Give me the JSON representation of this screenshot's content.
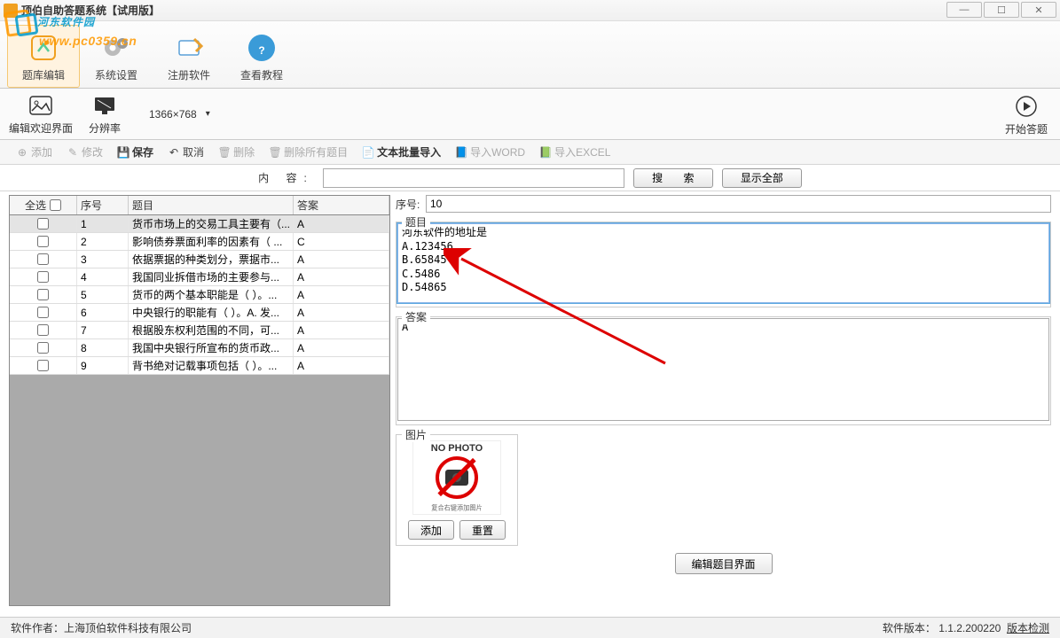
{
  "window": {
    "title": "顶伯自助答题系统【试用版】"
  },
  "watermark": {
    "text": "河东软件园",
    "url": "www.pc0359.cn"
  },
  "ribbon": {
    "items": [
      {
        "label": "题库编辑",
        "active": true
      },
      {
        "label": "系统设置",
        "active": false
      },
      {
        "label": "注册软件",
        "active": false
      },
      {
        "label": "查看教程",
        "active": false
      }
    ]
  },
  "subtoolbar": {
    "edit_welcome": "编辑欢迎界面",
    "resolution_label": "分辨率",
    "resolution_value": "1366×768",
    "start_answer": "开始答题"
  },
  "actions": {
    "add": "添加",
    "modify": "修改",
    "save": "保存",
    "cancel": "取消",
    "delete": "删除",
    "delete_all": "删除所有题目",
    "text_import": "文本批量导入",
    "import_word": "导入WORD",
    "import_excel": "导入EXCEL"
  },
  "search": {
    "label": "内 容:",
    "value": "",
    "search_btn": "搜 索",
    "showall_btn": "显示全部"
  },
  "table": {
    "select_all": "全选",
    "col_num": "序号",
    "col_title": "题目",
    "col_ans": "答案",
    "rows": [
      {
        "num": "1",
        "title": "货币市场上的交易工具主要有（...",
        "ans": "A"
      },
      {
        "num": "2",
        "title": "影响债券票面利率的因素有（ ...",
        "ans": "C"
      },
      {
        "num": "3",
        "title": "依据票据的种类划分，票据市...",
        "ans": "A"
      },
      {
        "num": "4",
        "title": "我国同业拆借市场的主要参与...",
        "ans": "A"
      },
      {
        "num": "5",
        "title": "货币的两个基本职能是（   ）。...",
        "ans": "A"
      },
      {
        "num": "6",
        "title": "中央银行的职能有（   ）。A. 发...",
        "ans": "A"
      },
      {
        "num": "7",
        "title": "根据股东权利范围的不同，可...",
        "ans": "A"
      },
      {
        "num": "8",
        "title": "我国中央银行所宣布的货币政...",
        "ans": "A"
      },
      {
        "num": "9",
        "title": "背书绝对记载事项包括（   ）。...",
        "ans": "A"
      }
    ]
  },
  "detail": {
    "seq_label": "序号:",
    "seq_value": "10",
    "question_label": "题目",
    "question_value": "河东软件的地址是\nA.123456\nB.65845\nC.5486\nD.54865",
    "answer_label": "答案",
    "answer_value": "A",
    "image_label": "图片",
    "no_photo": "NO PHOTO",
    "no_photo_hint": "复合右键添加图片",
    "add_btn": "添加",
    "reset_btn": "重置",
    "edit_ui_btn": "编辑题目界面"
  },
  "status": {
    "author_label": "软件作者：",
    "author": "上海顶伯软件科技有限公司",
    "version_label": "软件版本：",
    "version": "1.1.2.200220",
    "check_update": "版本检测"
  }
}
